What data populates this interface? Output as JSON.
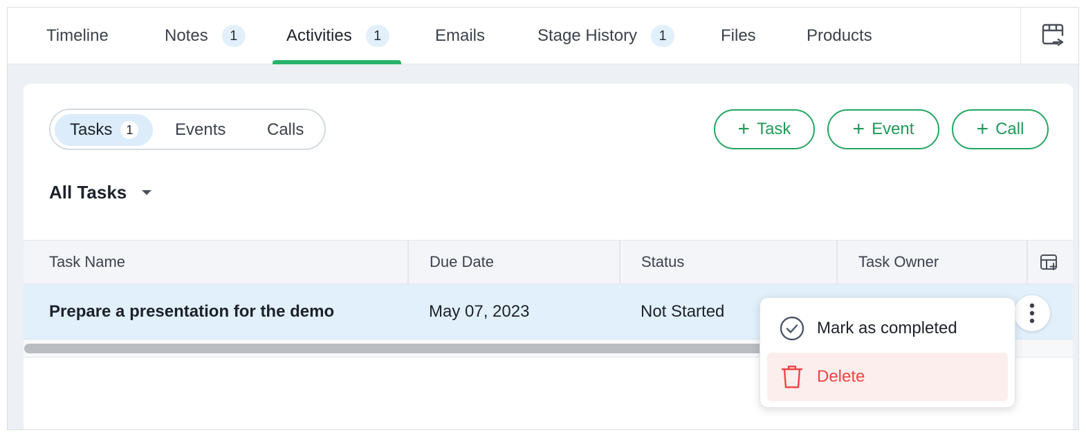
{
  "tabs": [
    {
      "label": "Timeline",
      "badge": null
    },
    {
      "label": "Notes",
      "badge": "1"
    },
    {
      "label": "Activities",
      "badge": "1",
      "active": true
    },
    {
      "label": "Emails",
      "badge": null
    },
    {
      "label": "Stage History",
      "badge": "1"
    },
    {
      "label": "Files",
      "badge": null
    },
    {
      "label": "Products",
      "badge": null
    }
  ],
  "activity_types": {
    "tasks": {
      "label": "Tasks",
      "count": "1"
    },
    "events": {
      "label": "Events"
    },
    "calls": {
      "label": "Calls"
    }
  },
  "add_buttons": {
    "task": "Task",
    "event": "Event",
    "call": "Call"
  },
  "filter": {
    "label": "All Tasks"
  },
  "table": {
    "columns": [
      "Task Name",
      "Due Date",
      "Status",
      "Task Owner"
    ],
    "rows": [
      {
        "name": "Prepare a presentation for the demo",
        "due": "May 07, 2023",
        "status": "Not Started"
      }
    ]
  },
  "row_menu": {
    "complete": "Mark as completed",
    "delete": "Delete"
  },
  "colors": {
    "accent_green": "#26b36a",
    "delete_red": "#ef4444",
    "row_highlight": "#e1f0fb"
  }
}
